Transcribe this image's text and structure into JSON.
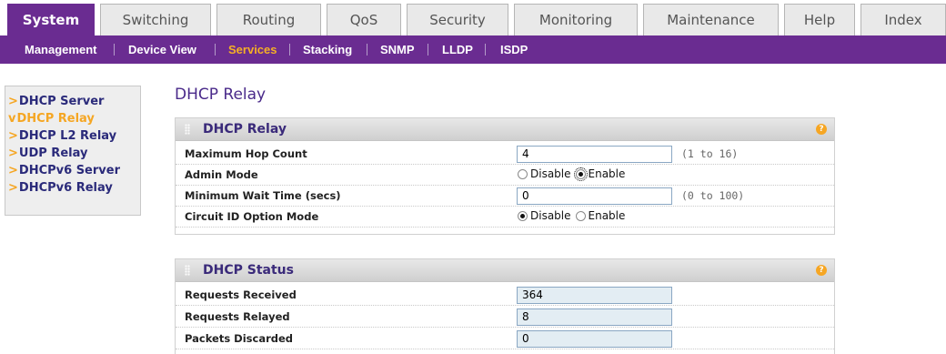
{
  "tabs": [
    "System",
    "Switching",
    "Routing",
    "QoS",
    "Security",
    "Monitoring",
    "Maintenance",
    "Help",
    "Index"
  ],
  "subnav": [
    "Management",
    "Device View",
    "Services",
    "Stacking",
    "SNMP",
    "LLDP",
    "ISDP"
  ],
  "sidebar": {
    "items": [
      {
        "label": "DHCP Server"
      },
      {
        "label": "DHCP Relay"
      },
      {
        "label": "DHCP L2 Relay"
      },
      {
        "label": "UDP Relay"
      },
      {
        "label": "DHCPv6 Server"
      },
      {
        "label": "DHCPv6 Relay"
      }
    ],
    "bullet_closed": ">",
    "bullet_open": "v"
  },
  "page_title": "DHCP Relay",
  "relay_panel": {
    "title": "DHCP Relay",
    "help": "?",
    "max_hop_label": "Maximum Hop Count",
    "max_hop_value": "4",
    "max_hop_hint": "(1 to 16)",
    "admin_mode_label": "Admin Mode",
    "min_wait_label": "Minimum Wait Time (secs)",
    "min_wait_value": "0",
    "min_wait_hint": "(0 to 100)",
    "circuit_label": "Circuit ID Option Mode",
    "disable": "Disable",
    "enable": "Enable",
    "admin_mode_selected": "Enable",
    "circuit_selected": "Disable"
  },
  "status_panel": {
    "title": "DHCP Status",
    "help": "?",
    "requests_received_label": "Requests Received",
    "requests_received_value": "364",
    "requests_relayed_label": "Requests Relayed",
    "requests_relayed_value": "8",
    "packets_discarded_label": "Packets Discarded",
    "packets_discarded_value": "0"
  },
  "colors": {
    "brand_purple": "#6a2c91",
    "active_orange": "#f5a623",
    "link_blue": "#2a2a7a"
  }
}
